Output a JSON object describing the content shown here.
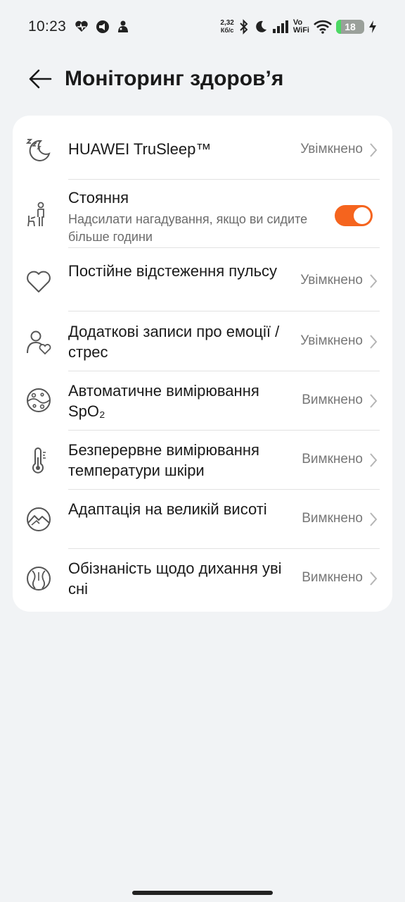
{
  "status_bar": {
    "time": "10:23",
    "net_speed_value": "2,32",
    "net_speed_unit": "Кб/с",
    "vowifi_top": "Vo",
    "vowifi_bottom": "WiFi",
    "battery_level": 18,
    "battery_label": "18"
  },
  "header": {
    "title": "Моніторинг здоров’я"
  },
  "rows": [
    {
      "title": "HUAWEI TruSleep™",
      "status": "Увімкнено",
      "icon": "sleep-icon"
    },
    {
      "title": "Стояння",
      "subtitle": "Надсилати нагадування, якщо ви сидите більше години",
      "toggle_on": true,
      "icon": "standing-icon"
    },
    {
      "title": "Постійне відстеження пульсу",
      "status": "Увімкнено",
      "icon": "heart-icon"
    },
    {
      "title": "Додаткові записи про емоції / стрес",
      "status": "Увімкнено",
      "icon": "emotion-icon"
    },
    {
      "title": "Автоматичне вимірювання SpO₂",
      "status": "Вимкнено",
      "icon": "spo2-icon"
    },
    {
      "title": "Безперервне вимірювання температури шкіри",
      "status": "Вимкнено",
      "icon": "thermometer-icon"
    },
    {
      "title": "Адаптація на великій висоті",
      "status": "Вимкнено",
      "icon": "mountain-icon"
    },
    {
      "title": "Обізнаність щодо дихання уві сні",
      "status": "Вимкнено",
      "icon": "breathing-icon"
    }
  ],
  "colors": {
    "accent": "#f5641e",
    "background": "#f1f3f5",
    "card": "#ffffff",
    "battery_fill": "#4cd964"
  }
}
